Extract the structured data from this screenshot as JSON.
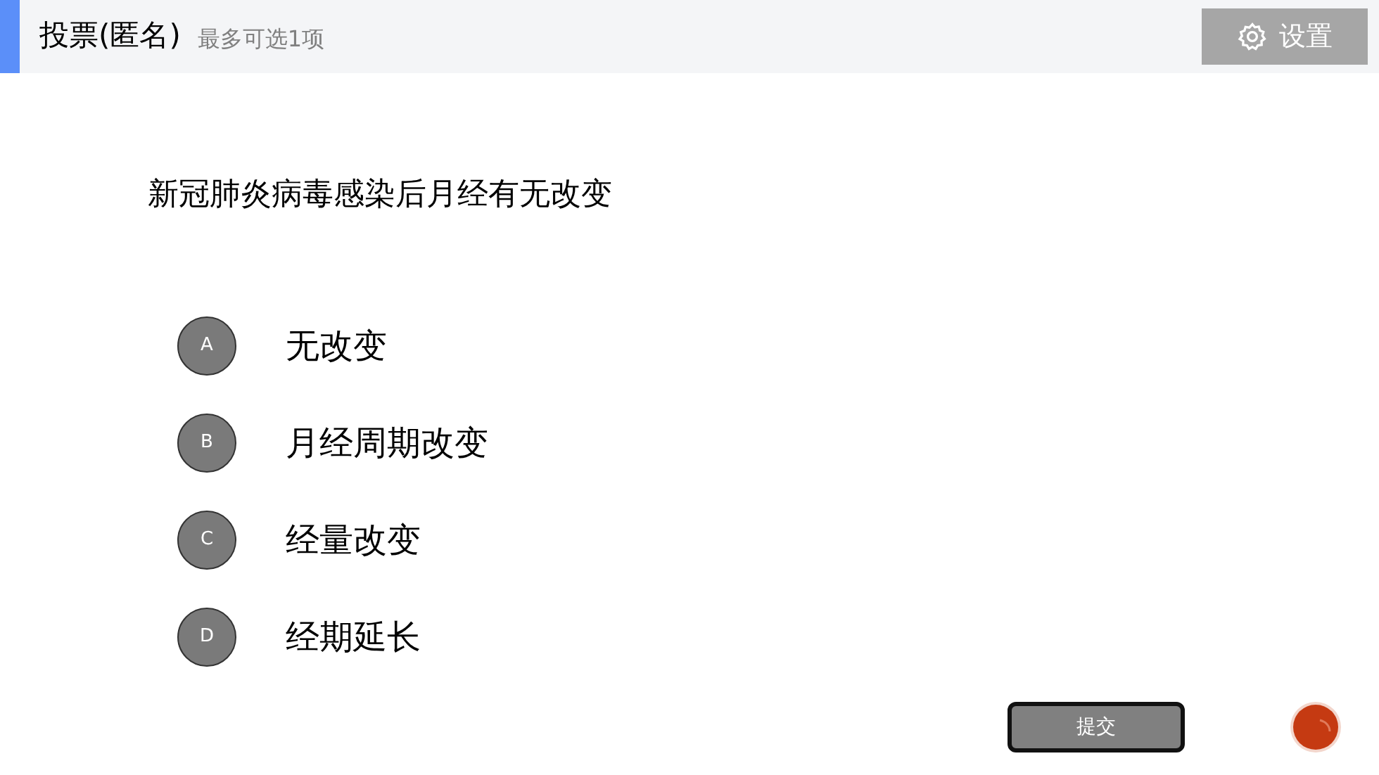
{
  "header": {
    "title": "投票(匿名)",
    "subtitle": "最多可选1项",
    "settings_button": "设置"
  },
  "question": "新冠肺炎病毒感染后月经有无改变",
  "options": [
    {
      "letter": "A",
      "text": "无改变",
      "selected": false
    },
    {
      "letter": "B",
      "text": "月经周期改变",
      "selected": false
    },
    {
      "letter": "C",
      "text": "经量改变",
      "selected": false
    },
    {
      "letter": "D",
      "text": "经期延长",
      "selected": false
    }
  ],
  "submit_button": "提交"
}
